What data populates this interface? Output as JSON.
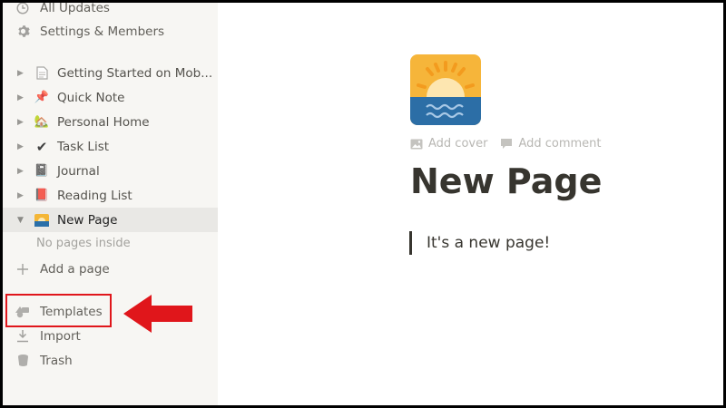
{
  "sidebar": {
    "top_items": [
      {
        "label": "All Updates",
        "icon": "clock-icon"
      },
      {
        "label": "Settings & Members",
        "icon": "gear-icon"
      }
    ],
    "pages": [
      {
        "label": "Getting Started on Mob...",
        "emoji": "📄",
        "expanded": false
      },
      {
        "label": "Quick Note",
        "emoji": "📌",
        "expanded": false
      },
      {
        "label": "Personal Home",
        "emoji": "🏡",
        "expanded": false
      },
      {
        "label": "Task List",
        "emoji": "✔",
        "expanded": false
      },
      {
        "label": "Journal",
        "emoji": "📓",
        "expanded": false
      },
      {
        "label": "Reading List",
        "emoji": "📕",
        "expanded": false
      },
      {
        "label": "New Page",
        "emoji": "🌅",
        "expanded": true
      }
    ],
    "no_pages_text": "No pages inside",
    "add_page_label": "Add a page",
    "bottom_items": [
      {
        "label": "Templates",
        "icon": "templates-icon"
      },
      {
        "label": "Import",
        "icon": "import-icon"
      },
      {
        "label": "Trash",
        "icon": "trash-icon"
      }
    ]
  },
  "main": {
    "page_icon": "sunrise-icon",
    "add_cover_label": "Add cover",
    "add_comment_label": "Add comment",
    "title": "New Page",
    "quote_text": "It's a new page!"
  },
  "colors": {
    "highlight": "#e0161b",
    "sidebar_bg": "#f7f6f3",
    "text": "#37352f"
  }
}
